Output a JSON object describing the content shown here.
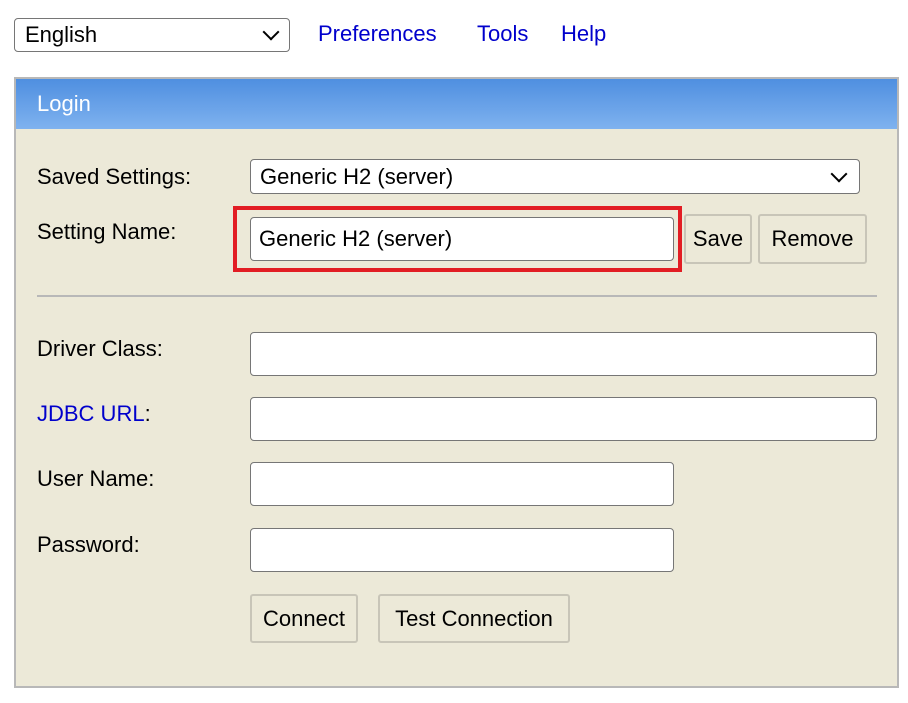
{
  "top_bar": {
    "language_selected": "English",
    "links": [
      "Preferences",
      "Tools",
      "Help"
    ]
  },
  "login_panel": {
    "title": "Login",
    "saved_settings": {
      "label": "Saved Settings:",
      "selected": "Generic H2 (server)"
    },
    "setting_name": {
      "label": "Setting Name:",
      "value": "Generic H2 (server)",
      "save_label": "Save",
      "remove_label": "Remove"
    },
    "driver_class": {
      "label": "Driver Class:",
      "value": ""
    },
    "jdbc_url": {
      "link_label": "JDBC URL",
      "suffix": ":",
      "value": ""
    },
    "user_name": {
      "label": "User Name:",
      "value": ""
    },
    "password": {
      "label": "Password:",
      "value": ""
    },
    "connect_label": "Connect",
    "test_connection_label": "Test Connection"
  },
  "colors": {
    "header_gradient_top": "#4f8fe0",
    "header_gradient_bottom": "#7fb2ef",
    "panel_background": "#ece9d8",
    "link": "#0000cc",
    "highlight": "#e21d24"
  }
}
